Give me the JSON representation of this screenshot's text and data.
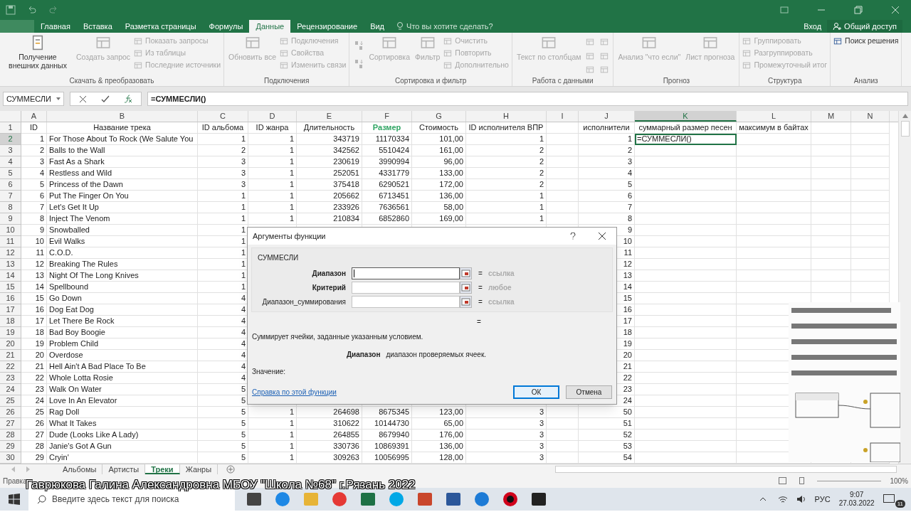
{
  "ribbon_tabs": [
    {
      "label": "Главная",
      "selected": false
    },
    {
      "label": "Вставка",
      "selected": false
    },
    {
      "label": "Разметка страницы",
      "selected": false
    },
    {
      "label": "Формулы",
      "selected": false
    },
    {
      "label": "Данные",
      "selected": true
    },
    {
      "label": "Рецензирование",
      "selected": false
    },
    {
      "label": "Вид",
      "selected": false
    }
  ],
  "tell_me": {
    "placeholder": "Что вы хотите сделать?"
  },
  "account": {
    "sign_in": "Вход",
    "share": "Общий доступ"
  },
  "ribbon_groups": [
    {
      "label": "Скачать & преобразовать",
      "items": [
        {
          "kind": "large",
          "label": "Получение внешних данных",
          "disabled": false
        },
        {
          "kind": "large",
          "label": "Создать запрос",
          "disabled": true
        },
        {
          "kind": "stack",
          "children": [
            {
              "label": "Показать запросы",
              "disabled": true
            },
            {
              "label": "Из таблицы",
              "disabled": true
            },
            {
              "label": "Последние источники",
              "disabled": true
            }
          ]
        }
      ]
    },
    {
      "label": "Подключения",
      "items": [
        {
          "kind": "large",
          "label": "Обновить все",
          "disabled": true
        },
        {
          "kind": "stack",
          "children": [
            {
              "label": "Подключения",
              "disabled": true
            },
            {
              "label": "Свойства",
              "disabled": true
            },
            {
              "label": "Изменить связи",
              "disabled": true
            }
          ]
        }
      ]
    },
    {
      "label": "Сортировка и фильтр",
      "items": [
        {
          "kind": "sort",
          "disabled": true
        },
        {
          "kind": "large",
          "label": "Сортировка",
          "disabled": true
        },
        {
          "kind": "large",
          "label": "Фильтр",
          "disabled": true
        },
        {
          "kind": "stack",
          "children": [
            {
              "label": "Очистить",
              "disabled": true
            },
            {
              "label": "Повторить",
              "disabled": true
            },
            {
              "label": "Дополнительно",
              "disabled": true
            }
          ]
        }
      ]
    },
    {
      "label": "Работа с данными",
      "items": [
        {
          "kind": "large",
          "label": "Текст по столбцам",
          "disabled": true
        },
        {
          "kind": "icons",
          "disabled": true
        }
      ]
    },
    {
      "label": "Прогноз",
      "items": [
        {
          "kind": "large",
          "label": "Анализ \"что если\"",
          "disabled": true
        },
        {
          "kind": "large",
          "label": "Лист прогноза",
          "disabled": true
        }
      ]
    },
    {
      "label": "Структура",
      "items": [
        {
          "kind": "stack",
          "children": [
            {
              "label": "Группировать",
              "disabled": true
            },
            {
              "label": "Разгруппировать",
              "disabled": true
            },
            {
              "label": "Промежуточный итог",
              "disabled": true
            }
          ]
        }
      ]
    },
    {
      "label": "Анализ",
      "items": [
        {
          "kind": "stack",
          "children": [
            {
              "label": "Поиск решения",
              "disabled": false
            }
          ]
        }
      ]
    }
  ],
  "formula_bar": {
    "name_box": "СУММЕСЛИ",
    "formula": "=СУММЕСЛИ()"
  },
  "sheet": {
    "columns": [
      {
        "letter": "A",
        "kind": "number",
        "selected": false
      },
      {
        "letter": "B",
        "kind": "text",
        "selected": false
      },
      {
        "letter": "C",
        "kind": "number",
        "selected": false
      },
      {
        "letter": "D",
        "kind": "number",
        "selected": false
      },
      {
        "letter": "E",
        "kind": "number",
        "selected": false
      },
      {
        "letter": "F",
        "kind": "number",
        "selected": false
      },
      {
        "letter": "G",
        "kind": "number",
        "selected": false
      },
      {
        "letter": "H",
        "kind": "number",
        "selected": false
      },
      {
        "letter": "I",
        "kind": "number",
        "selected": false
      },
      {
        "letter": "J",
        "kind": "number",
        "selected": false
      },
      {
        "letter": "K",
        "kind": "text",
        "selected": true
      },
      {
        "letter": "L",
        "kind": "text",
        "selected": false
      },
      {
        "letter": "M",
        "kind": "text",
        "selected": false
      },
      {
        "letter": "N",
        "kind": "text",
        "selected": false
      }
    ],
    "rows": [
      {
        "num": "1",
        "kind": "header",
        "selected": false,
        "cells": [
          "ID",
          "Название трека",
          "ID альбома",
          "ID жанра",
          "Длительность",
          {
            "text": "Размер",
            "emphasis": true
          },
          "Стоимость",
          "ID исполнителя ВПР",
          null,
          "исполнители",
          "суммарный размер песен",
          "максимум в байтах"
        ]
      },
      {
        "num": "2",
        "kind": "data",
        "selected": true,
        "cells": [
          "1",
          "For Those About To Rock (We Salute You",
          "1",
          "1",
          "343719",
          "11170334",
          "101,00",
          "1",
          null,
          "1",
          {
            "text": "=СУММЕСЛИ()",
            "active": true
          }
        ]
      },
      {
        "num": "3",
        "kind": "data",
        "selected": false,
        "cells": [
          "2",
          "Balls to the Wall",
          "2",
          "1",
          "342562",
          "5510424",
          "161,00",
          "2",
          null,
          "2"
        ]
      },
      {
        "num": "4",
        "kind": "data",
        "selected": false,
        "cells": [
          "3",
          "Fast As a Shark",
          "3",
          "1",
          "230619",
          "3990994",
          "96,00",
          "2",
          null,
          "3"
        ]
      },
      {
        "num": "5",
        "kind": "data",
        "selected": false,
        "cells": [
          "4",
          "Restless and Wild",
          "3",
          "1",
          "252051",
          "4331779",
          "133,00",
          "2",
          null,
          "4"
        ]
      },
      {
        "num": "6",
        "kind": "data",
        "selected": false,
        "cells": [
          "5",
          "Princess of the Dawn",
          "3",
          "1",
          "375418",
          "6290521",
          "172,00",
          "2",
          null,
          "5"
        ]
      },
      {
        "num": "7",
        "kind": "data",
        "selected": false,
        "cells": [
          "6",
          "Put The Finger On You",
          "1",
          "1",
          "205662",
          "6713451",
          "136,00",
          "1",
          null,
          "6"
        ]
      },
      {
        "num": "8",
        "kind": "data",
        "selected": false,
        "cells": [
          "7",
          "Let's Get It Up",
          "1",
          "1",
          "233926",
          "7636561",
          "58,00",
          "1",
          null,
          "7"
        ]
      },
      {
        "num": "9",
        "kind": "data",
        "selected": false,
        "cells": [
          "8",
          "Inject The Venom",
          "1",
          "1",
          "210834",
          "6852860",
          "169,00",
          "1",
          null,
          "8"
        ]
      },
      {
        "num": "10",
        "kind": "data",
        "selected": false,
        "cells": [
          "9",
          "Snowballed",
          "1",
          null,
          null,
          null,
          null,
          null,
          null,
          "9"
        ]
      },
      {
        "num": "11",
        "kind": "data",
        "selected": false,
        "cells": [
          "10",
          "Evil Walks",
          "1",
          null,
          null,
          null,
          null,
          null,
          null,
          "10"
        ]
      },
      {
        "num": "12",
        "kind": "data",
        "selected": false,
        "cells": [
          "11",
          "C.O.D.",
          "1",
          null,
          null,
          null,
          null,
          null,
          null,
          "11"
        ]
      },
      {
        "num": "13",
        "kind": "data",
        "selected": false,
        "cells": [
          "12",
          "Breaking The Rules",
          "1",
          null,
          null,
          null,
          null,
          null,
          null,
          "12"
        ]
      },
      {
        "num": "14",
        "kind": "data",
        "selected": false,
        "cells": [
          "13",
          "Night Of The Long Knives",
          "1",
          null,
          null,
          null,
          null,
          null,
          null,
          "13"
        ]
      },
      {
        "num": "15",
        "kind": "data",
        "selected": false,
        "cells": [
          "14",
          "Spellbound",
          "1",
          null,
          null,
          null,
          null,
          null,
          null,
          "14"
        ]
      },
      {
        "num": "16",
        "kind": "data",
        "selected": false,
        "cells": [
          "15",
          "Go Down",
          "4",
          null,
          null,
          null,
          null,
          null,
          null,
          "15"
        ]
      },
      {
        "num": "17",
        "kind": "data",
        "selected": false,
        "cells": [
          "16",
          "Dog Eat Dog",
          "4",
          null,
          null,
          null,
          null,
          null,
          null,
          "16"
        ]
      },
      {
        "num": "18",
        "kind": "data",
        "selected": false,
        "cells": [
          "17",
          "Let There Be Rock",
          "4",
          null,
          null,
          null,
          null,
          null,
          null,
          "17"
        ]
      },
      {
        "num": "19",
        "kind": "data",
        "selected": false,
        "cells": [
          "18",
          "Bad Boy Boogie",
          "4",
          null,
          null,
          null,
          null,
          null,
          null,
          "18"
        ]
      },
      {
        "num": "20",
        "kind": "data",
        "selected": false,
        "cells": [
          "19",
          "Problem Child",
          "4",
          null,
          null,
          null,
          null,
          null,
          null,
          "19"
        ]
      },
      {
        "num": "21",
        "kind": "data",
        "selected": false,
        "cells": [
          "20",
          "Overdose",
          "4",
          null,
          null,
          null,
          null,
          null,
          null,
          "20"
        ]
      },
      {
        "num": "22",
        "kind": "data",
        "selected": false,
        "cells": [
          "21",
          "Hell Ain't A Bad Place To Be",
          "4",
          null,
          null,
          null,
          null,
          null,
          null,
          "21"
        ]
      },
      {
        "num": "23",
        "kind": "data",
        "selected": false,
        "cells": [
          "22",
          "Whole Lotta Rosie",
          "4",
          null,
          null,
          null,
          null,
          null,
          null,
          "22"
        ]
      },
      {
        "num": "24",
        "kind": "data",
        "selected": false,
        "cells": [
          "23",
          "Walk On Water",
          "5",
          null,
          null,
          null,
          null,
          null,
          null,
          "23"
        ]
      },
      {
        "num": "25",
        "kind": "data",
        "selected": false,
        "cells": [
          "24",
          "Love In An Elevator",
          "5",
          null,
          null,
          null,
          null,
          null,
          null,
          "24"
        ]
      },
      {
        "num": "26",
        "kind": "data",
        "selected": false,
        "cells": [
          "25",
          "Rag Doll",
          "5",
          "1",
          "264698",
          "8675345",
          "123,00",
          "3",
          null,
          "50"
        ]
      },
      {
        "num": "27",
        "kind": "data",
        "selected": false,
        "cells": [
          "26",
          "What It Takes",
          "5",
          "1",
          "310622",
          "10144730",
          "65,00",
          "3",
          null,
          "51"
        ]
      },
      {
        "num": "28",
        "kind": "data",
        "selected": false,
        "cells": [
          "27",
          "Dude (Looks Like A Lady)",
          "5",
          "1",
          "264855",
          "8679940",
          "176,00",
          "3",
          null,
          "52"
        ]
      },
      {
        "num": "29",
        "kind": "data",
        "selected": false,
        "cells": [
          "28",
          "Janie's Got A Gun",
          "5",
          "1",
          "330736",
          "10869391",
          "136,00",
          "3",
          null,
          "53"
        ]
      },
      {
        "num": "30",
        "kind": "data",
        "selected": false,
        "cells": [
          "29",
          "Cryin'",
          "5",
          "1",
          "309263",
          "10056995",
          "128,00",
          "3",
          null,
          "54"
        ]
      }
    ]
  },
  "dialog": {
    "title": "Аргументы функции",
    "function": "СУММЕСЛИ",
    "args": [
      {
        "label": "Диапазон",
        "required": true,
        "focused": true,
        "hint": "ссылка",
        "sign": "="
      },
      {
        "label": "Критерий",
        "required": true,
        "focused": false,
        "hint": "любое",
        "sign": "="
      },
      {
        "label": "Диапазон_суммирования",
        "required": false,
        "focused": false,
        "hint": "ссылка",
        "sign": "="
      }
    ],
    "result_sign": "=",
    "description": "Суммирует ячейки, заданные указанным условием.",
    "arg_name": "Диапазон",
    "arg_description": "диапазон проверяемых ячеек.",
    "value_label": "Значение:",
    "help_link": "Справка по этой функции",
    "buttons": [
      {
        "label": "ОК",
        "default": true
      },
      {
        "label": "Отмена",
        "default": false
      }
    ]
  },
  "sheet_tabs": [
    {
      "label": "Альбомы",
      "selected": false
    },
    {
      "label": "Артисты",
      "selected": false
    },
    {
      "label": "Треки",
      "selected": true
    },
    {
      "label": "Жанры",
      "selected": false
    }
  ],
  "status_bar": {
    "mode": "Правка",
    "zoom": "100%"
  },
  "caption": "Гаврюкова Галина Александровна МБОУ \"Школа №68\" г.Рязань 2022",
  "taskbar": {
    "search_placeholder": "Введите здесь текст для поиска",
    "language": "РУС",
    "time": "9:07",
    "date": "27.03.2022",
    "notifications": "11"
  }
}
